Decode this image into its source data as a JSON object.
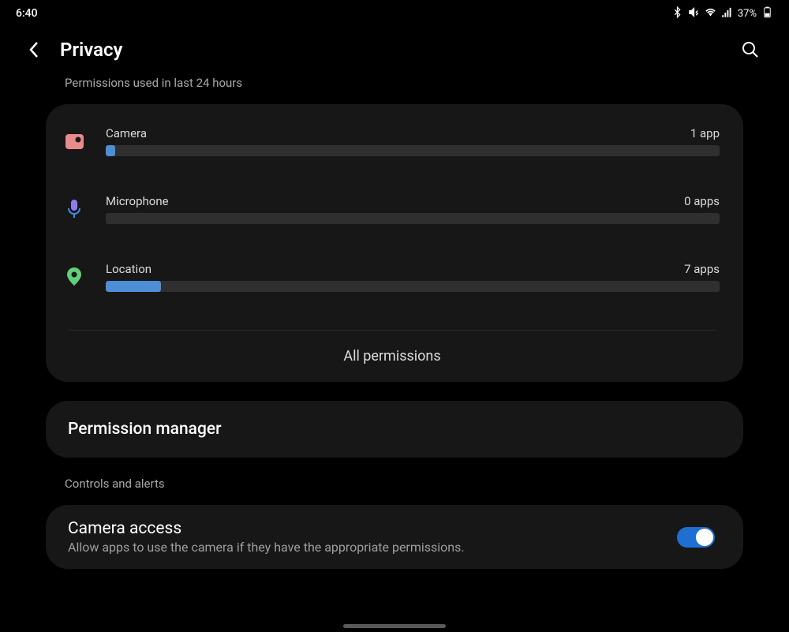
{
  "status": {
    "time": "6:40",
    "battery": "37%"
  },
  "header": {
    "title": "Privacy"
  },
  "sectionLabel": "Permissions used in last 24 hours",
  "permissions": {
    "camera": {
      "label": "Camera",
      "count": "1 app",
      "fill": 1.5
    },
    "microphone": {
      "label": "Microphone",
      "count": "0 apps",
      "fill": 0
    },
    "location": {
      "label": "Location",
      "count": "7 apps",
      "fill": 9
    }
  },
  "allPermissions": "All permissions",
  "permissionManager": "Permission manager",
  "controlsLabel": "Controls and alerts",
  "cameraAccess": {
    "title": "Camera access",
    "subtitle": "Allow apps to use the camera if they have the appropriate permissions."
  },
  "colors": {
    "cameraIcon": "#e78b8b",
    "micIcon": "#8d7ef0",
    "locationIcon": "#5fd17a",
    "barFill": "#4d8ed6",
    "switchOn": "#1f6fd1"
  }
}
